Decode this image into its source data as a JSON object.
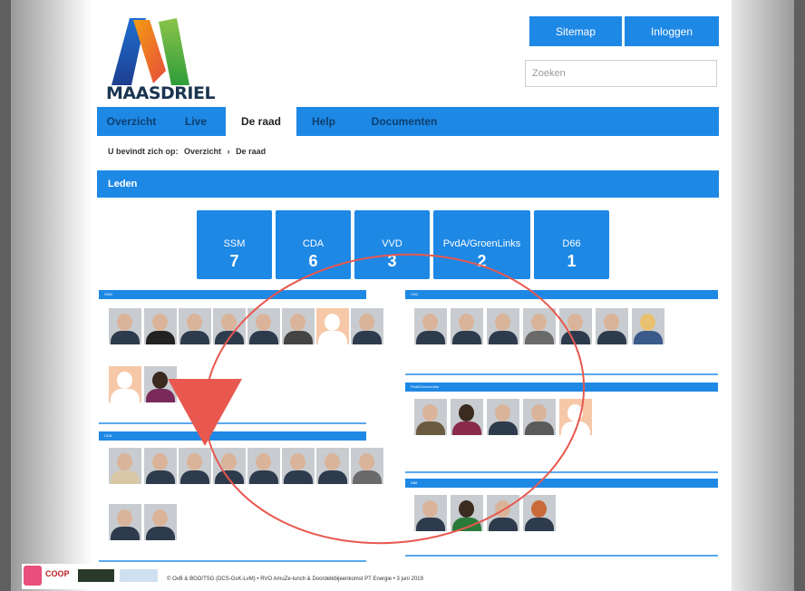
{
  "site": {
    "logo_text": "MAASDRIEL",
    "sitemap_label": "Sitemap",
    "login_label": "Inloggen",
    "search_placeholder": "Zoeken"
  },
  "nav": [
    "Overzicht",
    "Live",
    "De raad",
    "Help",
    "Documenten"
  ],
  "breadcrumb": {
    "prefix": "U bevindt zich op:",
    "items": [
      "Overzicht",
      "›",
      "De raad"
    ]
  },
  "leden_title": "Leden",
  "parties": [
    {
      "name": "SSM",
      "count": "7"
    },
    {
      "name": "CDA",
      "count": "6"
    },
    {
      "name": "VVD",
      "count": "3"
    },
    {
      "name": "PvdA/GroenLinks",
      "count": "2"
    },
    {
      "name": "D66",
      "count": "1"
    }
  ],
  "sections": {
    "ssm_title": "SSM",
    "cda_title": "CDA",
    "vvd_title": "VVD",
    "pvda_title": "PvdA/GroenLinks",
    "d66_title": "D66"
  },
  "footer": {
    "text": "© OvB & BGO/TSG (DCS-GsK-LvM) • RVO AmuZe-lunch & Doordelkbijeenkomst PT Energie • 3 juni 2019",
    "coop_label": "COOP"
  },
  "colors": {
    "accent": "#1e88e5",
    "annotation": "#e8584f"
  }
}
